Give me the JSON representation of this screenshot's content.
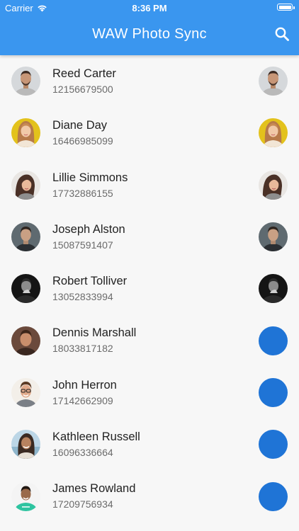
{
  "status_bar": {
    "carrier": "Carrier",
    "time": "8:36 PM"
  },
  "app_bar": {
    "title": "WAW Photo Sync",
    "color": "#3a96ef"
  },
  "contacts": [
    {
      "name": "Reed Carter",
      "phone": "12156679500",
      "synced": true
    },
    {
      "name": "Diane Day",
      "phone": "16466985099",
      "synced": true
    },
    {
      "name": "Lillie Simmons",
      "phone": "17732886155",
      "synced": true
    },
    {
      "name": "Joseph Alston",
      "phone": "15087591407",
      "synced": true
    },
    {
      "name": "Robert Tolliver",
      "phone": "13052833994",
      "synced": true
    },
    {
      "name": "Dennis Marshall",
      "phone": "18033817182",
      "synced": false
    },
    {
      "name": "John Herron",
      "phone": "17142662909",
      "synced": false
    },
    {
      "name": "Kathleen Russell",
      "phone": "16096336664",
      "synced": false
    },
    {
      "name": "James Rowland",
      "phone": "17209756934",
      "synced": false
    }
  ],
  "placeholder_color": "#1f74d6"
}
